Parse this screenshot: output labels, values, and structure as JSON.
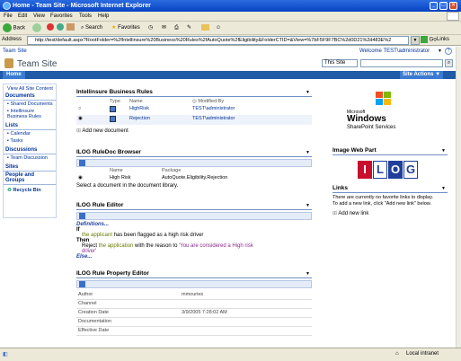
{
  "browser": {
    "title": "Home - Team Site - Microsoft Internet Explorer",
    "menu": [
      "File",
      "Edit",
      "View",
      "Favorites",
      "Tools",
      "Help"
    ],
    "toolbar": {
      "back": "Back",
      "search": "Search",
      "favorites": "Favorites"
    },
    "address_label": "Address",
    "url": "http://test/default.aspx?RootFolder=%2fIntellinsure%20Business%20Rules%2fAutoQuote%2fEligibility&FolderCTID=&View=%7bF5F9F7BC%2d0D21%2d483E%2",
    "go": "Go",
    "links": "Links",
    "status": "Local intranet"
  },
  "site": {
    "breadcrumb": "Team Site",
    "welcome": "Welcome TEST\\administrator",
    "title": "Team Site",
    "search_scope": "This Site",
    "home_tab": "Home",
    "site_actions": "Site Actions"
  },
  "quicklaunch": {
    "view_all": "View All Site Content",
    "documents": "Documents",
    "doc_items": [
      "Shared Documents",
      "Intellinsure Business Rules"
    ],
    "lists": "Lists",
    "list_items": [
      "Calendar",
      "Tasks"
    ],
    "discussions": "Discussions",
    "discussion_items": [
      "Team Discussion"
    ],
    "sites": "Sites",
    "people": "People and Groups",
    "recycle": "Recycle Bin"
  },
  "rules_wp": {
    "title": "Intellinsure Business Rules",
    "headers": [
      "Type",
      "Name",
      "Modified By"
    ],
    "rows": [
      {
        "name": "HighRisk",
        "modified": "TEST\\administrator"
      },
      {
        "name": "Rejection",
        "modified": "TEST\\administrator"
      }
    ],
    "add": "Add new document"
  },
  "browser_wp": {
    "title": "ILOG RuleDoc Browser",
    "headers": [
      "Name",
      "Package"
    ],
    "row": {
      "name": "High Risk",
      "package": "AutoQuote.Eligibility.Rejection"
    },
    "hint": "Select a document in the document library."
  },
  "editor_wp": {
    "title": "ILOG Rule Editor",
    "definitions": "Definitions...",
    "if": "If",
    "cond_a": "the applicant",
    "cond_b": " has been flagged as a high risk driver",
    "then": "Then",
    "act_a": "Reject ",
    "act_b": "the application",
    "act_c": " with the reason to ",
    "act_d": "'You are considered a High risk driver'",
    "else": "Else..."
  },
  "prop_wp": {
    "title": "ILOG Rule Property Editor",
    "rows": [
      {
        "k": "Author",
        "v": "mmouries"
      },
      {
        "k": "Channel",
        "v": ""
      },
      {
        "k": "Creation Date",
        "v": "3/9/2005 7:28:02 AM"
      },
      {
        "k": "Documentation",
        "v": ""
      },
      {
        "k": "Effective Date",
        "v": ""
      }
    ]
  },
  "right": {
    "logo_microsoft": "Microsoft",
    "logo_windows": "Windows",
    "logo_sps": "SharePoint Services",
    "image_wp": "Image Web Part",
    "ilog": "ILOG",
    "links_title": "Links",
    "links_text": "There are currently no favorite links to display. To add a new link, click \"Add new link\" below.",
    "add_link": "Add new link"
  }
}
